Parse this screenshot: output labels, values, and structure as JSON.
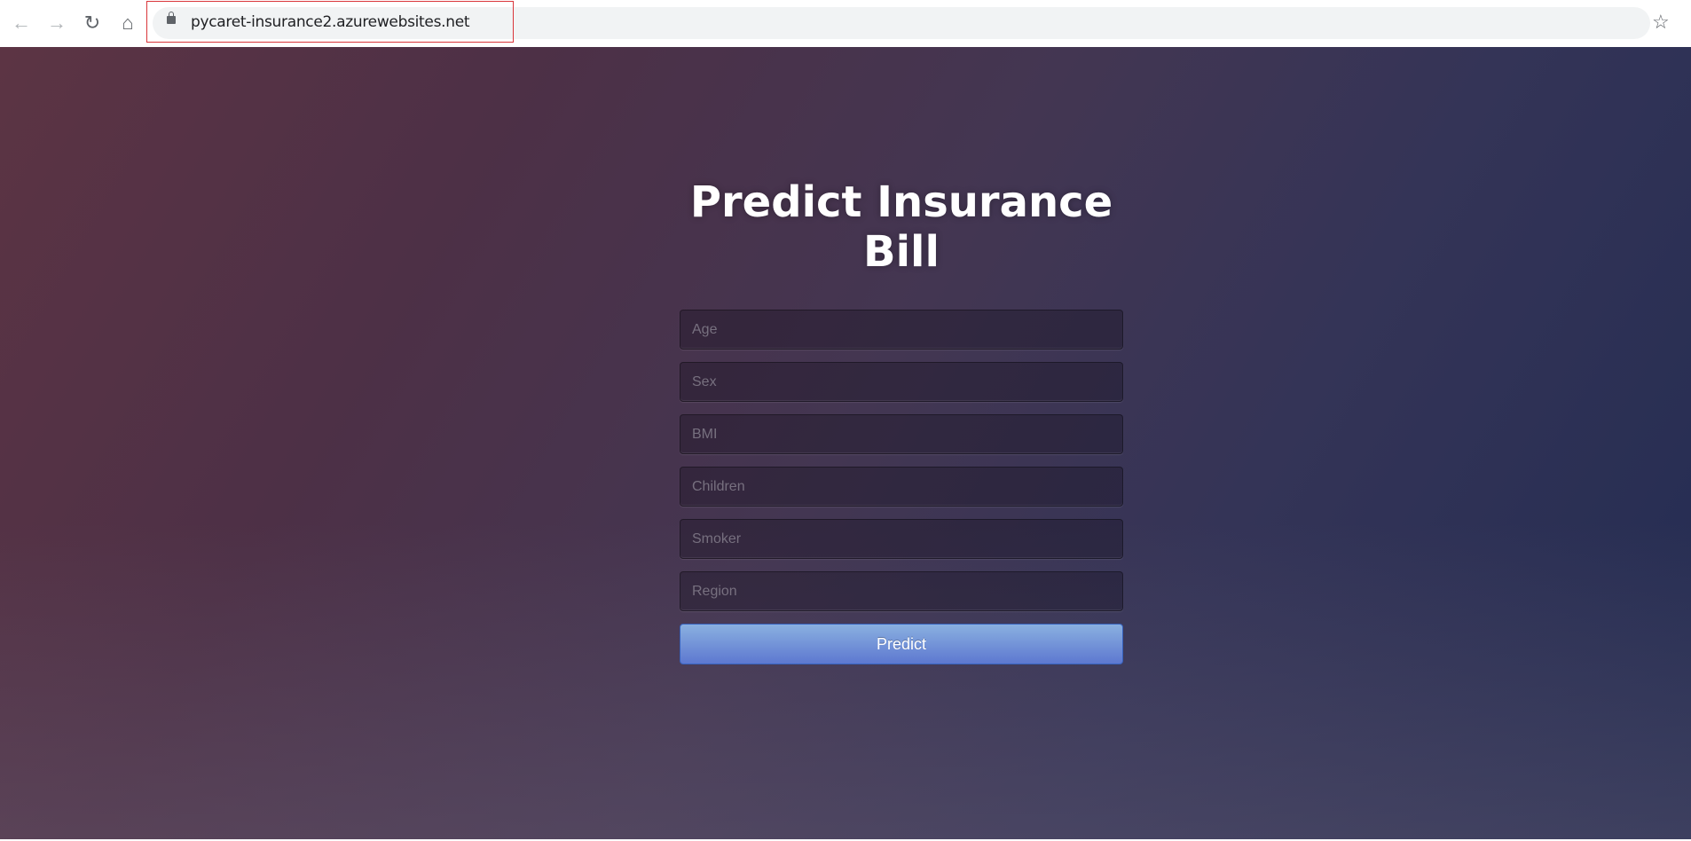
{
  "browser": {
    "url": "pycaret-insurance2.azurewebsites.net",
    "icons": [
      "back-arrow-icon",
      "forward-arrow-icon",
      "reload-icon",
      "home-icon",
      "lock-icon",
      "star-icon"
    ]
  },
  "form": {
    "title": "Predict Insurance Bill",
    "fields": [
      {
        "placeholder": "Age"
      },
      {
        "placeholder": "Sex"
      },
      {
        "placeholder": "BMI"
      },
      {
        "placeholder": "Children"
      },
      {
        "placeholder": "Smoker"
      },
      {
        "placeholder": "Region"
      }
    ],
    "submit_label": "Predict"
  },
  "colors": {
    "button_top": "#8ab0e0",
    "button_bottom": "#5d78d0",
    "highlight_box": "#d9353a"
  }
}
